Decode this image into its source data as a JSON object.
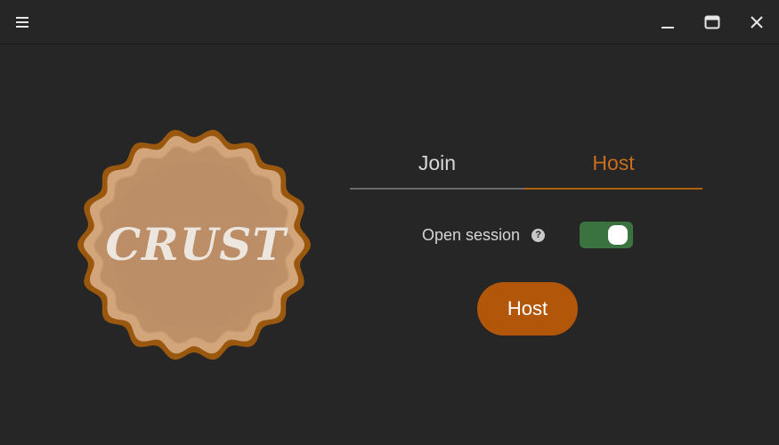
{
  "titlebar": {
    "menu_icon": "hamburger-menu-icon",
    "minimize_icon": "minimize-icon",
    "maximize_icon": "maximize-icon",
    "close_icon": "close-icon"
  },
  "logo": {
    "text": "CRUST"
  },
  "tabs": [
    {
      "label": "Join",
      "active": false
    },
    {
      "label": "Host",
      "active": true
    }
  ],
  "session": {
    "label": "Open session",
    "help_glyph": "?",
    "toggle_on": true
  },
  "actions": {
    "host_label": "Host"
  },
  "colors": {
    "background": "#262626",
    "accent": "#c96e1c",
    "button": "#b2570a",
    "toggle_on": "#3b7340",
    "logo_fill": "#bd9068",
    "logo_edge": "#9a570e"
  }
}
